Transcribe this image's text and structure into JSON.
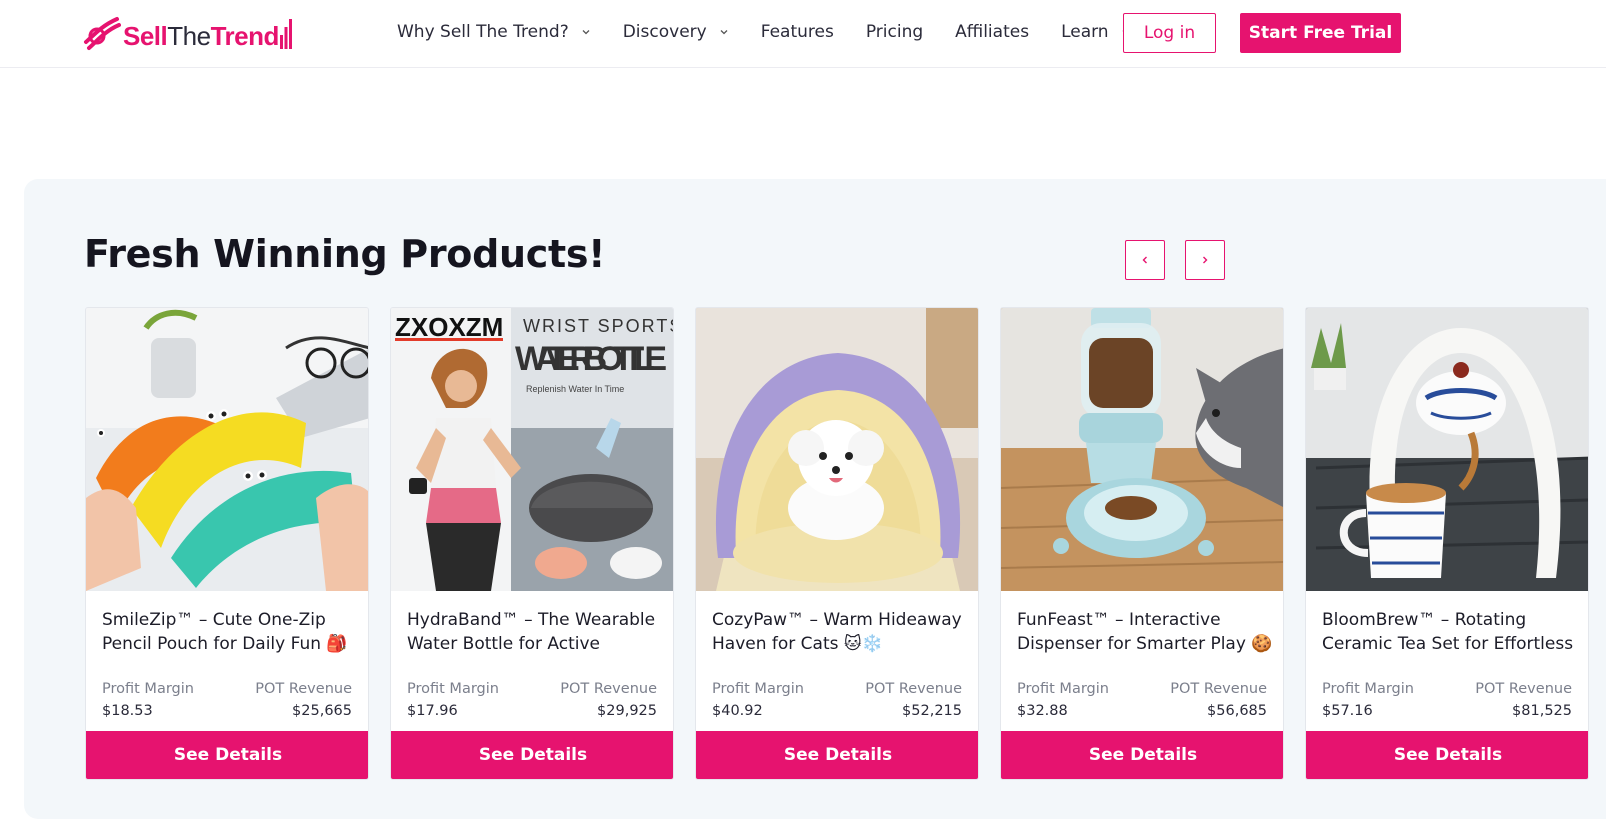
{
  "header": {
    "logo": {
      "part1": "Sell",
      "part2": "The",
      "part3": "Trend"
    },
    "nav": [
      {
        "label": "Why Sell The Trend?",
        "dropdown": true
      },
      {
        "label": "Discovery",
        "dropdown": true
      },
      {
        "label": "Features",
        "dropdown": false
      },
      {
        "label": "Pricing",
        "dropdown": false
      },
      {
        "label": "Affiliates",
        "dropdown": false
      },
      {
        "label": "Learn",
        "dropdown": true
      }
    ],
    "login_label": "Log in",
    "trial_label": "Start Free Trial"
  },
  "section": {
    "title": "Fresh Winning Products!",
    "prev_icon": "chevron-left-icon",
    "next_icon": "chevron-right-icon"
  },
  "labels": {
    "profit_margin": "Profit Margin",
    "pot_revenue": "POT Revenue",
    "see_details": "See Details"
  },
  "products": [
    {
      "title": "SmileZip™ – Cute One-Zip Pencil Pouch for Daily Fun 🎒",
      "profit_margin": "$18.53",
      "pot_revenue": "$25,665",
      "image": "colorful-pencil-pouches"
    },
    {
      "title": "HydraBand™ – The Wearable Water Bottle for Active",
      "profit_margin": "$17.96",
      "pot_revenue": "$29,925",
      "image": "wrist-water-bottle",
      "image_text": {
        "brand": "ZXOXZM",
        "line1": "WRIST SPORTS",
        "line2": "WATER BOTTLE",
        "tagline": "Replenish Water In Time"
      }
    },
    {
      "title": "CozyPaw™ – Warm Hideaway Haven for Cats 🐱❄️",
      "profit_margin": "$40.92",
      "pot_revenue": "$52,215",
      "image": "dog-in-pet-bed"
    },
    {
      "title": "FunFeast™ – Interactive Dispenser for Smarter Play 🍪",
      "profit_margin": "$32.88",
      "pot_revenue": "$56,685",
      "image": "cat-food-dispenser"
    },
    {
      "title": "BloomBrew™ – Rotating Ceramic Tea Set for Effortless",
      "profit_margin": "$57.16",
      "pot_revenue": "$81,525",
      "image": "ceramic-tea-set"
    }
  ],
  "colors": {
    "brand": "#e6136f",
    "section_bg": "#f3f7fa"
  }
}
